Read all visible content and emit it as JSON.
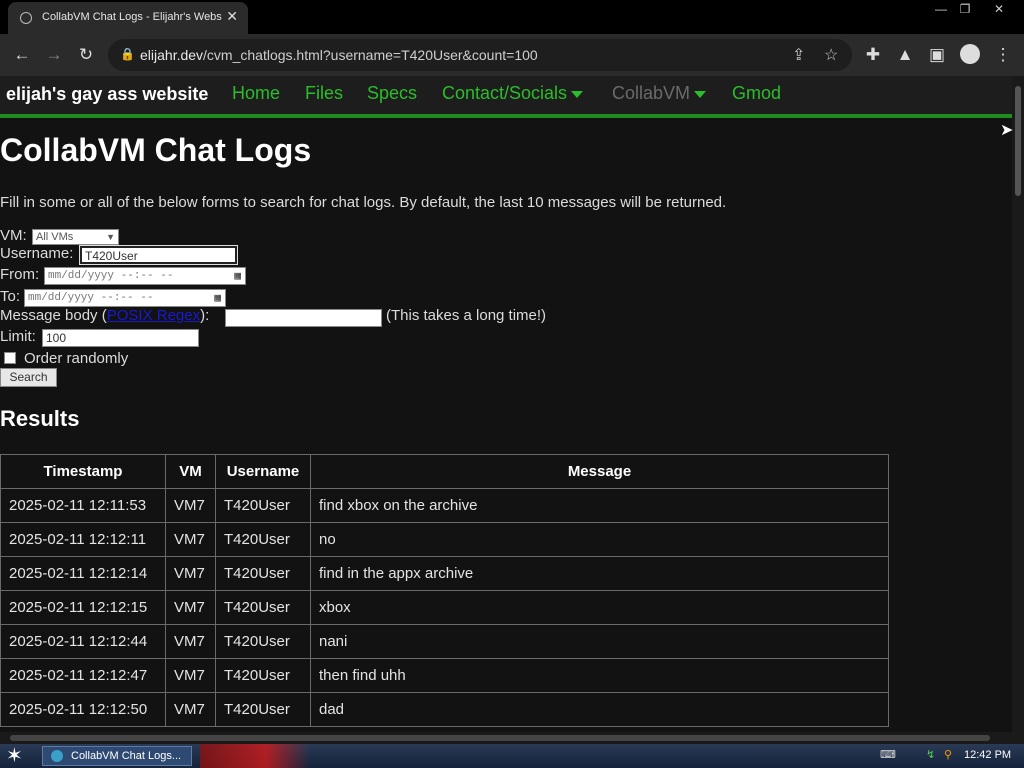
{
  "browser": {
    "tab_title": "CollabVM Chat Logs - Elijahr's Website",
    "tab_close": "✕",
    "url_host": "elijahr.dev",
    "url_rest": "/cvm_chatlogs.html?username=T420User&count=100",
    "window_controls": [
      "—",
      "❐",
      "✕"
    ]
  },
  "site_nav": {
    "brand": "elijah's gay ass website",
    "items": [
      "Home",
      "Files",
      "Specs",
      "Contact/Socials",
      "CollabVM",
      "Gmod"
    ]
  },
  "page": {
    "title": "CollabVM Chat Logs",
    "intro": "Fill in some or all of the below forms to search for chat logs. By default, the last 10 messages will be returned.",
    "form": {
      "vm_label": "VM:",
      "vm_selected": "All VMs",
      "username_label": "Username:",
      "username_value": "T420User",
      "from_label": "From:",
      "to_label": "To:",
      "date_placeholder": "mm/dd/yyyy --:-- --",
      "body_label": "Message body (",
      "body_link": "POSIX Regex",
      "body_label_end": "):",
      "body_note": "(This takes a long time!)",
      "limit_label": "Limit:",
      "limit_value": "100",
      "random_label": "Order randomly",
      "search_button": "Search"
    },
    "results_heading": "Results",
    "table": {
      "headers": [
        "Timestamp",
        "VM",
        "Username",
        "Message"
      ],
      "rows": [
        [
          "2025-02-11 12:11:53",
          "VM7",
          "T420User",
          "find xbox on the archive"
        ],
        [
          "2025-02-11 12:12:11",
          "VM7",
          "T420User",
          "no"
        ],
        [
          "2025-02-11 12:12:14",
          "VM7",
          "T420User",
          "find in the appx archive"
        ],
        [
          "2025-02-11 12:12:15",
          "VM7",
          "T420User",
          "xbox"
        ],
        [
          "2025-02-11 12:12:44",
          "VM7",
          "T420User",
          "nani"
        ],
        [
          "2025-02-11 12:12:47",
          "VM7",
          "T420User",
          "then find uhh"
        ],
        [
          "2025-02-11 12:12:50",
          "VM7",
          "T420User",
          "dad"
        ]
      ]
    }
  },
  "taskbar": {
    "task_label": "CollabVM Chat Logs...",
    "clock": "12:42 PM"
  },
  "colors": {
    "nav_green": "#2bbd2b",
    "nav_border": "#1e8c1e",
    "page_bg": "#121212"
  }
}
